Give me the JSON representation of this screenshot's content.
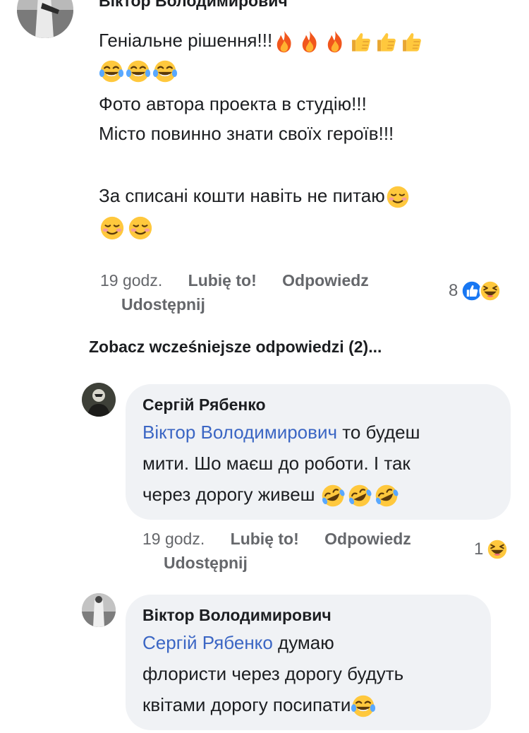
{
  "comments": [
    {
      "author": "Віктор Володимирович",
      "lines": [
        "Геніальне рішення!!!",
        "",
        "Фото автора проекта в студію!!!",
        "Місто повинно знати своїх героїв!!!",
        "",
        "За списані кошти навіть не питаю",
        ""
      ],
      "time": "19 godz.",
      "like": "Lubię to!",
      "reply": "Odpowiedz",
      "share": "Udostępnij",
      "reactions_count": "8"
    },
    {
      "author": "Сергій Рябенко",
      "mention": "Віктор Володимирович",
      "line1_rest": " то будеш",
      "line2": "мити. Шо маєш до роботи. І так",
      "line3": "через дорогу живеш ",
      "time": "19 godz.",
      "like": "Lubię to!",
      "reply": "Odpowiedz",
      "share": "Udostępnij",
      "reactions_count": "1"
    },
    {
      "author": "Віктор Володимирович",
      "mention": "Сергій Рябенко",
      "line1_rest": "  думаю",
      "line2": "флористи через дорогу будуть",
      "line3": "квітами дорогу посипати"
    }
  ],
  "previous_replies": "Zobacz wcześniejsze odpowiedzi (2)...",
  "colors": {
    "bubble": "#f0f2f5",
    "mention": "#3b66c4",
    "meta": "#65676b",
    "like_blue": "#1877f2",
    "emoji_yellow": "#ffc83d"
  },
  "icons": [
    "fire-emoji",
    "thumbs-up-emoji",
    "tears-of-joy-emoji",
    "smiling-emoji",
    "rofl-emoji",
    "like-reaction-icon",
    "haha-reaction-icon"
  ]
}
